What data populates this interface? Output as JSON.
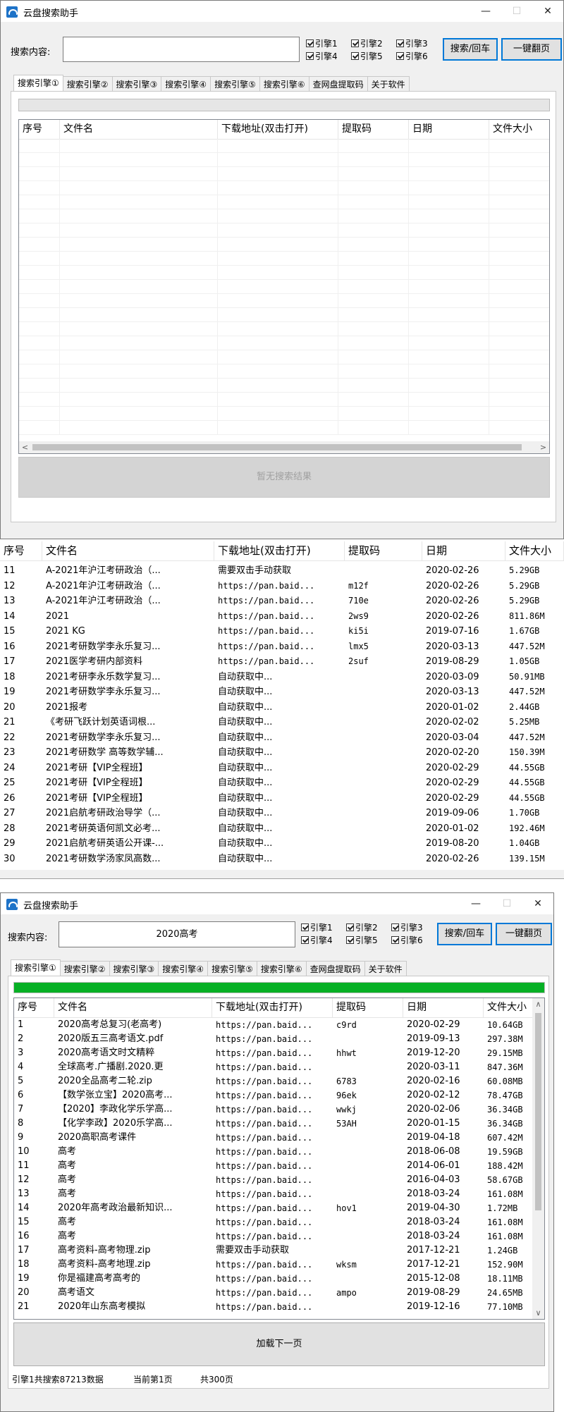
{
  "app": {
    "title": "云盘搜索助手"
  },
  "window_controls": {
    "minimize": "—",
    "maximize": "☐",
    "close": "✕"
  },
  "search": {
    "label": "搜索内容:",
    "empty_value": "",
    "query": "2020高考"
  },
  "engines": [
    {
      "label": "引擎1",
      "checked": true
    },
    {
      "label": "引擎2",
      "checked": true
    },
    {
      "label": "引擎3",
      "checked": true
    },
    {
      "label": "引擎4",
      "checked": true
    },
    {
      "label": "引擎5",
      "checked": true
    },
    {
      "label": "引擎6",
      "checked": true
    }
  ],
  "buttons": {
    "search": "搜索/回车",
    "next_page_all": "一键翻页"
  },
  "tabs": [
    "搜索引擎①",
    "搜索引擎②",
    "搜索引擎③",
    "搜索引擎④",
    "搜索引擎⑤",
    "搜索引擎⑥",
    "查网盘提取码",
    "关于软件"
  ],
  "columns": [
    "序号",
    "文件名",
    "下载地址(双击打开)",
    "提取码",
    "日期",
    "文件大小"
  ],
  "progress": {
    "empty_percent": 0,
    "loaded_percent": 100
  },
  "empty_window": {
    "no_results": "暂无搜索结果"
  },
  "scroll_arrows": {
    "left": "<",
    "right": ">",
    "up": "∧",
    "down": "∨"
  },
  "middle_results": [
    [
      "11",
      "A-2021年沪江考研政治（...",
      "需要双击手动获取",
      "",
      "2020-02-26",
      "5.29GB"
    ],
    [
      "12",
      "A-2021年沪江考研政治（...",
      "https://pan.baid...",
      "m12f",
      "2020-02-26",
      "5.29GB"
    ],
    [
      "13",
      "A-2021年沪江考研政治（...",
      "https://pan.baid...",
      "710e",
      "2020-02-26",
      "5.29GB"
    ],
    [
      "14",
      "2021",
      "https://pan.baid...",
      "2ws9",
      "2020-02-26",
      "811.86M"
    ],
    [
      "15",
      "2021 KG",
      "https://pan.baid...",
      "ki5i",
      "2019-07-16",
      "1.67GB"
    ],
    [
      "16",
      "2021考研数学李永乐复习...",
      "https://pan.baid...",
      "lmx5",
      "2020-03-13",
      "447.52M"
    ],
    [
      "17",
      "2021医学考研内部资料",
      "https://pan.baid...",
      "2suf",
      "2019-08-29",
      "1.05GB"
    ],
    [
      "18",
      "2021考研李永乐数学复习...",
      "自动获取中...",
      "",
      "2020-03-09",
      "50.91MB"
    ],
    [
      "19",
      "2021考研数学李永乐复习...",
      "自动获取中...",
      "",
      "2020-03-13",
      "447.52M"
    ],
    [
      "20",
      "2021报考",
      "自动获取中...",
      "",
      "2020-01-02",
      "2.44GB"
    ],
    [
      "21",
      "《考研飞跃计划英语词根...",
      "自动获取中...",
      "",
      "2020-02-02",
      "5.25MB"
    ],
    [
      "22",
      "2021考研数学李永乐复习...",
      "自动获取中...",
      "",
      "2020-03-04",
      "447.52M"
    ],
    [
      "23",
      "2021考研数学 高等数学辅...",
      "自动获取中...",
      "",
      "2020-02-20",
      "150.39M"
    ],
    [
      "24",
      "2021考研【VIP全程班】",
      "自动获取中...",
      "",
      "2020-02-29",
      "44.55GB"
    ],
    [
      "25",
      "2021考研【VIP全程班】",
      "自动获取中...",
      "",
      "2020-02-29",
      "44.55GB"
    ],
    [
      "26",
      "2021考研【VIP全程班】",
      "自动获取中...",
      "",
      "2020-02-29",
      "44.55GB"
    ],
    [
      "27",
      "2021启航考研政治导学（...",
      "自动获取中...",
      "",
      "2019-09-06",
      "1.70GB"
    ],
    [
      "28",
      "2021考研英语何凯文必考...",
      "自动获取中...",
      "",
      "2020-01-02",
      "192.46M"
    ],
    [
      "29",
      "2021启航考研英语公开课-...",
      "自动获取中...",
      "",
      "2019-08-20",
      "1.04GB"
    ],
    [
      "30",
      "2021考研数学汤家凤高数...",
      "自动获取中...",
      "",
      "2020-02-26",
      "139.15M"
    ]
  ],
  "bottom_results": [
    [
      "1",
      "2020高考总复习(老高考)",
      "https://pan.baid...",
      "c9rd",
      "2020-02-29",
      "10.64GB"
    ],
    [
      "2",
      "2020版五三高考语文.pdf",
      "https://pan.baid...",
      "",
      "2019-09-13",
      "297.38M"
    ],
    [
      "3",
      "2020高考语文时文精粹",
      "https://pan.baid...",
      "hhwt",
      "2019-12-20",
      "29.15MB"
    ],
    [
      "4",
      "全球高考.广播剧.2020.更",
      "https://pan.baid...",
      "",
      "2020-03-11",
      "847.36M"
    ],
    [
      "5",
      "2020全品高考二轮.zip",
      "https://pan.baid...",
      "6783",
      "2020-02-16",
      "60.08MB"
    ],
    [
      "6",
      "【数学张立宝】2020高考...",
      "https://pan.baid...",
      "96ek",
      "2020-02-12",
      "78.47GB"
    ],
    [
      "7",
      "【2020】李政化学乐学高...",
      "https://pan.baid...",
      "wwkj",
      "2020-02-06",
      "36.34GB"
    ],
    [
      "8",
      "【化学李政】2020乐学高...",
      "https://pan.baid...",
      "53AH",
      "2020-01-15",
      "36.34GB"
    ],
    [
      "9",
      "2020高职高考课件",
      "https://pan.baid...",
      "",
      "2019-04-18",
      "607.42M"
    ],
    [
      "10",
      "高考",
      "https://pan.baid...",
      "",
      "2018-06-08",
      "19.59GB"
    ],
    [
      "11",
      "高考",
      "https://pan.baid...",
      "",
      "2014-06-01",
      "188.42M"
    ],
    [
      "12",
      "高考",
      "https://pan.baid...",
      "",
      "2016-04-03",
      "58.67GB"
    ],
    [
      "13",
      "高考",
      "https://pan.baid...",
      "",
      "2018-03-24",
      "161.08M"
    ],
    [
      "14",
      "2020年高考政治最新知识...",
      "https://pan.baid...",
      "hov1",
      "2019-04-30",
      "1.72MB"
    ],
    [
      "15",
      "高考",
      "https://pan.baid...",
      "",
      "2018-03-24",
      "161.08M"
    ],
    [
      "16",
      "高考",
      "https://pan.baid...",
      "",
      "2018-03-24",
      "161.08M"
    ],
    [
      "17",
      "高考资料-高考物理.zip",
      "需要双击手动获取",
      "",
      "2017-12-21",
      "1.24GB"
    ],
    [
      "18",
      "高考资料-高考地理.zip",
      "https://pan.baid...",
      "wksm",
      "2017-12-21",
      "152.90M"
    ],
    [
      "19",
      "你是福建高考高考的",
      "https://pan.baid...",
      "",
      "2015-12-08",
      "18.11MB"
    ],
    [
      "20",
      "高考语文",
      "https://pan.baid...",
      "ampo",
      "2019-08-29",
      "24.65MB"
    ],
    [
      "21",
      "2020年山东高考模拟",
      "https://pan.baid...",
      "",
      "2019-12-16",
      "77.10MB"
    ]
  ],
  "load_more": "加载下一页",
  "status_bar": {
    "count": "引擎1共搜索87213数据",
    "current_page": "当前第1页",
    "total": "共300页"
  },
  "colors": {
    "progress_green": "#06b025",
    "primary_border": "#0078d7"
  }
}
